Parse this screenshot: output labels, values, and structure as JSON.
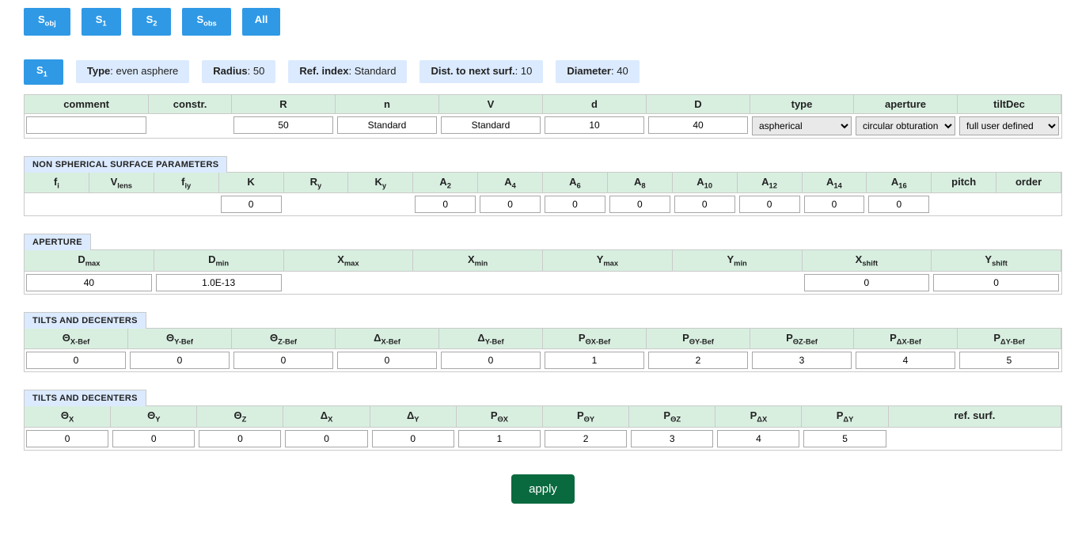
{
  "tabs": {
    "s_prefix": "S",
    "s_obj_sub": "obj",
    "s1_sub": "1",
    "s2_sub": "2",
    "s_obs_sub": "obs",
    "all": "All"
  },
  "summary": {
    "s_prefix": "S",
    "s_sub": "1",
    "type_label": "Type",
    "type_value": "even asphere",
    "radius_label": "Radius",
    "radius_value": "50",
    "refidx_label": "Ref. index",
    "refidx_value": "Standard",
    "dist_label": "Dist. to next surf.",
    "dist_value": "10",
    "diam_label": "Diameter",
    "diam_value": "40"
  },
  "main": {
    "headers": {
      "comment": "comment",
      "constr": "constr.",
      "R": "R",
      "n": "n",
      "V": "V",
      "d": "d",
      "D": "D",
      "type": "type",
      "aperture": "aperture",
      "tiltDec": "tiltDec"
    },
    "values": {
      "comment": "",
      "R": "50",
      "n": "Standard",
      "V": "Standard",
      "d": "10",
      "D": "40",
      "type_sel": "aspherical",
      "aperture_sel": "circular obturation",
      "tiltDec_sel": "full user defined"
    },
    "type_options": [
      "aspherical"
    ],
    "aperture_options": [
      "circular obturation"
    ],
    "tiltDec_options": [
      "full user defined"
    ]
  },
  "ns": {
    "legend": "NON SPHERICAL SURFACE PARAMETERS",
    "headers": {
      "fi": "f",
      "fi_sub": "i",
      "Vlens": "V",
      "Vlens_sub": "lens",
      "fiy": "f",
      "fiy_sub": "iy",
      "K": "K",
      "Ry": "R",
      "Ry_sub": "y",
      "Ky": "K",
      "Ky_sub": "y",
      "A2": "A",
      "A2_sub": "2",
      "A4": "A",
      "A4_sub": "4",
      "A6": "A",
      "A6_sub": "6",
      "A8": "A",
      "A8_sub": "8",
      "A10": "A",
      "A10_sub": "10",
      "A12": "A",
      "A12_sub": "12",
      "A14": "A",
      "A14_sub": "14",
      "A16": "A",
      "A16_sub": "16",
      "pitch": "pitch",
      "order": "order"
    },
    "values": {
      "K": "0",
      "A2": "0",
      "A4": "0",
      "A6": "0",
      "A8": "0",
      "A10": "0",
      "A12": "0",
      "A14": "0",
      "A16": "0"
    }
  },
  "ap": {
    "legend": "APERTURE",
    "headers": {
      "Dmax": "D",
      "Dmax_sub": "max",
      "Dmin": "D",
      "Dmin_sub": "min",
      "Xmax": "X",
      "Xmax_sub": "max",
      "Xmin": "X",
      "Xmin_sub": "min",
      "Ymax": "Y",
      "Ymax_sub": "max",
      "Ymin": "Y",
      "Ymin_sub": "min",
      "Xshift": "X",
      "Xshift_sub": "shift",
      "Yshift": "Y",
      "Yshift_sub": "shift"
    },
    "values": {
      "Dmax": "40",
      "Dmin": "1.0E-13",
      "Xshift": "0",
      "Yshift": "0"
    }
  },
  "tb": {
    "legend": "TILTS AND DECENTERS",
    "headers": {
      "thxb": "Θ",
      "thxb_sub": "X-Bef",
      "thyb": "Θ",
      "thyb_sub": "Y-Bef",
      "thzb": "Θ",
      "thzb_sub": "Z-Bef",
      "dxb": "Δ",
      "dxb_sub": "X-Bef",
      "dyb": "Δ",
      "dyb_sub": "Y-Bef",
      "pthxb": "P",
      "pthxb_sub": "ΘX-Bef",
      "pthyb": "P",
      "pthyb_sub": "ΘY-Bef",
      "pthzb": "P",
      "pthzb_sub": "ΘZ-Bef",
      "pdxb": "P",
      "pdxb_sub": "ΔX-Bef",
      "pdyb": "P",
      "pdyb_sub": "ΔY-Bef"
    },
    "values": {
      "thxb": "0",
      "thyb": "0",
      "thzb": "0",
      "dxb": "0",
      "dyb": "0",
      "pthxb": "1",
      "pthyb": "2",
      "pthzb": "3",
      "pdxb": "4",
      "pdyb": "5"
    }
  },
  "ta": {
    "legend": "TILTS AND DECENTERS",
    "headers": {
      "thx": "Θ",
      "thx_sub": "X",
      "thy": "Θ",
      "thy_sub": "Y",
      "thz": "Θ",
      "thz_sub": "Z",
      "dx": "Δ",
      "dx_sub": "X",
      "dy": "Δ",
      "dy_sub": "Y",
      "pthx": "P",
      "pthx_sub": "ΘX",
      "pthy": "P",
      "pthy_sub": "ΘY",
      "pthz": "P",
      "pthz_sub": "ΘZ",
      "pdx": "P",
      "pdx_sub": "ΔX",
      "pdy": "P",
      "pdy_sub": "ΔY",
      "rs": "ref. surf."
    },
    "values": {
      "thx": "0",
      "thy": "0",
      "thz": "0",
      "dx": "0",
      "dy": "0",
      "pthx": "1",
      "pthy": "2",
      "pthz": "3",
      "pdx": "4",
      "pdy": "5"
    }
  },
  "apply_label": "apply"
}
